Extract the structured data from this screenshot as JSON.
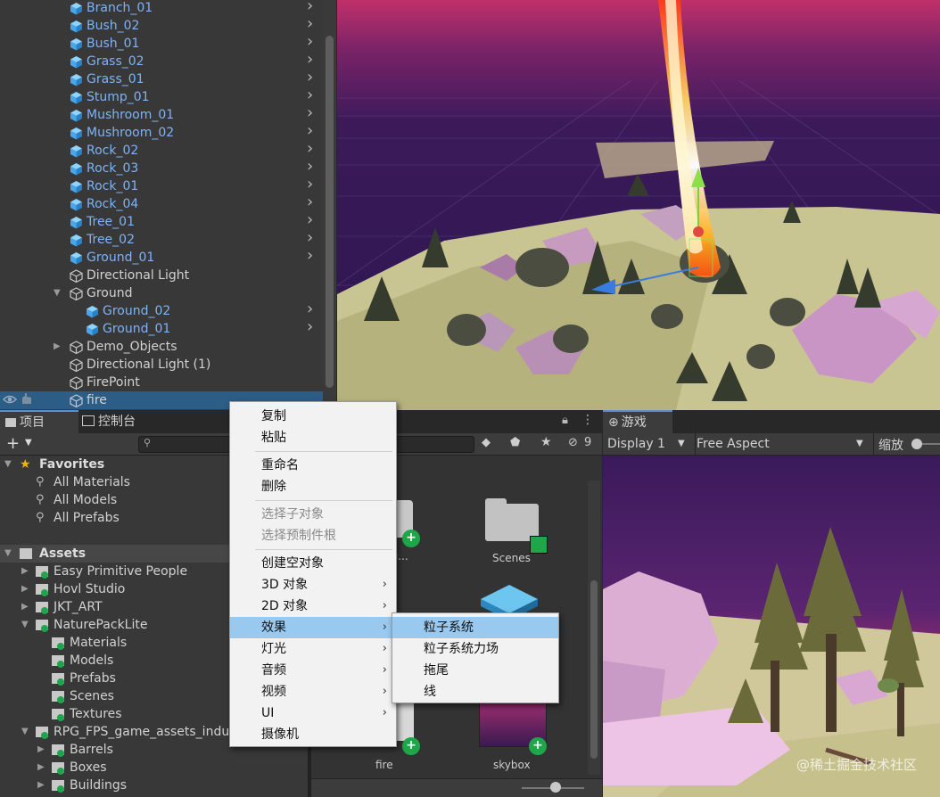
{
  "hierarchy": {
    "items": [
      {
        "label": "Branch_01",
        "type": "prefab",
        "indent": 0,
        "arrow": true
      },
      {
        "label": "Bush_02",
        "type": "prefab",
        "indent": 0,
        "arrow": true
      },
      {
        "label": "Bush_01",
        "type": "prefab",
        "indent": 0,
        "arrow": true
      },
      {
        "label": "Grass_02",
        "type": "prefab",
        "indent": 0,
        "arrow": true
      },
      {
        "label": "Grass_01",
        "type": "prefab",
        "indent": 0,
        "arrow": true
      },
      {
        "label": "Stump_01",
        "type": "prefab",
        "indent": 0,
        "arrow": true
      },
      {
        "label": "Mushroom_01",
        "type": "prefab",
        "indent": 0,
        "arrow": true
      },
      {
        "label": "Mushroom_02",
        "type": "prefab",
        "indent": 0,
        "arrow": true
      },
      {
        "label": "Rock_02",
        "type": "prefab",
        "indent": 0,
        "arrow": true
      },
      {
        "label": "Rock_03",
        "type": "prefab",
        "indent": 0,
        "arrow": true
      },
      {
        "label": "Rock_01",
        "type": "prefab",
        "indent": 0,
        "arrow": true
      },
      {
        "label": "Rock_04",
        "type": "prefab",
        "indent": 0,
        "arrow": true
      },
      {
        "label": "Tree_01",
        "type": "prefab",
        "indent": 0,
        "arrow": true
      },
      {
        "label": "Tree_02",
        "type": "prefab",
        "indent": 0,
        "arrow": true
      },
      {
        "label": "Ground_01",
        "type": "prefab",
        "indent": 0,
        "arrow": true
      },
      {
        "label": "Directional Light",
        "type": "object",
        "indent": 0,
        "arrow": false
      },
      {
        "label": "Ground",
        "type": "object",
        "indent": 0,
        "arrow": false,
        "fold": "open"
      },
      {
        "label": "Ground_02",
        "type": "prefab",
        "indent": 1,
        "arrow": true
      },
      {
        "label": "Ground_01",
        "type": "prefab",
        "indent": 1,
        "arrow": true
      },
      {
        "label": "Demo_Objects",
        "type": "object",
        "indent": 0,
        "arrow": false,
        "fold": "closed"
      },
      {
        "label": "Directional Light (1)",
        "type": "object",
        "indent": 0,
        "arrow": false
      },
      {
        "label": "FirePoint",
        "type": "object",
        "indent": 0,
        "arrow": false
      },
      {
        "label": "fire",
        "type": "object",
        "indent": 0,
        "arrow": false,
        "selected": true
      }
    ]
  },
  "project": {
    "tab_project": "项目",
    "tab_console": "控制台",
    "add_label": "+",
    "hidden_count": "9",
    "favorites_label": "Favorites",
    "favorites": [
      "All Materials",
      "All Models",
      "All Prefabs"
    ],
    "assets_label": "Assets",
    "tree": [
      {
        "label": "Easy Primitive People",
        "indent": 1,
        "fold": "closed"
      },
      {
        "label": "Hovl Studio",
        "indent": 1,
        "fold": "closed"
      },
      {
        "label": "JKT_ART",
        "indent": 1,
        "fold": "closed"
      },
      {
        "label": "NaturePackLite",
        "indent": 1,
        "fold": "open"
      },
      {
        "label": "Materials",
        "indent": 2,
        "fold": "none"
      },
      {
        "label": "Models",
        "indent": 2,
        "fold": "none"
      },
      {
        "label": "Prefabs",
        "indent": 2,
        "fold": "none"
      },
      {
        "label": "Scenes",
        "indent": 2,
        "fold": "none"
      },
      {
        "label": "Textures",
        "indent": 2,
        "fold": "none"
      },
      {
        "label": "RPG_FPS_game_assets_indu",
        "indent": 1,
        "fold": "open"
      },
      {
        "label": "Barrels",
        "indent": 2,
        "fold": "closed"
      },
      {
        "label": "Boxes",
        "indent": 2,
        "fold": "closed"
      },
      {
        "label": "Buildings",
        "indent": 2,
        "fold": "closed"
      }
    ],
    "grid": {
      "partial_label": "S_g...",
      "scenes_label": "Scenes",
      "fire_label": "fire",
      "skybox_label": "skybox"
    }
  },
  "game": {
    "tab_label": "游戏",
    "display": "Display 1",
    "aspect": "Free Aspect",
    "scale_label": "缩放"
  },
  "context_menu": {
    "items": [
      {
        "label": "复制",
        "enabled": true
      },
      {
        "label": "粘贴",
        "enabled": true
      },
      {
        "sep": true
      },
      {
        "label": "重命名",
        "enabled": true
      },
      {
        "label": "删除",
        "enabled": true
      },
      {
        "sep": true
      },
      {
        "label": "选择子对象",
        "enabled": false
      },
      {
        "label": "选择预制件根",
        "enabled": false
      },
      {
        "sep": true
      },
      {
        "label": "创建空对象",
        "enabled": true
      },
      {
        "label": "3D 对象",
        "enabled": true,
        "submenu": true
      },
      {
        "label": "2D 对象",
        "enabled": true,
        "submenu": true
      },
      {
        "label": "效果",
        "enabled": true,
        "submenu": true,
        "highlighted": true
      },
      {
        "label": "灯光",
        "enabled": true,
        "submenu": true
      },
      {
        "label": "音频",
        "enabled": true,
        "submenu": true
      },
      {
        "label": "视频",
        "enabled": true,
        "submenu": true
      },
      {
        "label": "UI",
        "enabled": true,
        "submenu": true
      },
      {
        "label": "摄像机",
        "enabled": true
      }
    ]
  },
  "submenu": {
    "items": [
      {
        "label": "粒子系统",
        "highlighted": true
      },
      {
        "label": "粒子系统力场"
      },
      {
        "label": "拖尾"
      },
      {
        "label": "线"
      }
    ]
  },
  "watermark": "@稀土掘金技术社区",
  "colors": {
    "prefab_text": "#7fb3f5",
    "selection": "#2c5d87",
    "menu_highlight": "#99c9ef",
    "accent_green": "#1fa64a"
  }
}
